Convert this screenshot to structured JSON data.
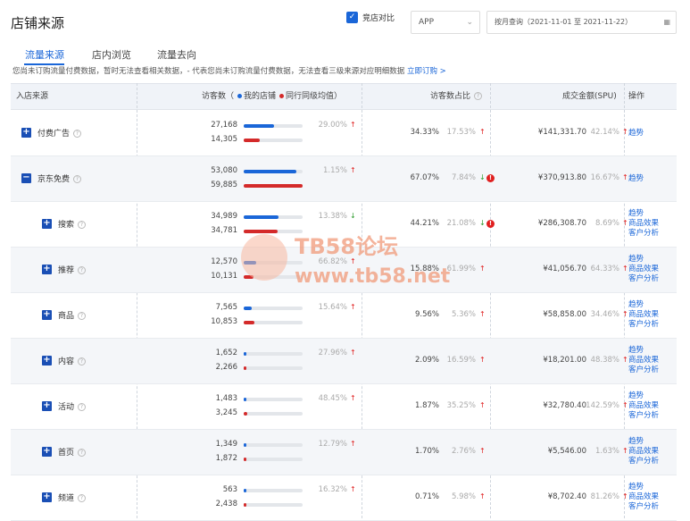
{
  "page": {
    "title": "店铺来源"
  },
  "controls": {
    "compare_label": "竞店对比",
    "platform": "APP",
    "date_range": "按月查询（2021-11-01 至 2021-11-22）"
  },
  "tabs": [
    "流量来源",
    "店内浏览",
    "流量去向"
  ],
  "notice": {
    "text": "您尚未订购流量付费数据，暂时无法查看相关数据，- 代表您尚未订购流量付费数据，无法查看三级来源对应明细数据",
    "link": "立即订购 >"
  },
  "table": {
    "headers": {
      "source": "入店来源",
      "visitors": "访客数（",
      "mine": "我的店铺",
      "peer": "同行同级均值）",
      "share": "访客数占比",
      "amount": "成交金额(SPU)",
      "ops": "操作"
    },
    "rows": [
      {
        "name": "付费广告",
        "icon": "plus-icon",
        "indent": 0,
        "mine": "27,168",
        "peer": "14,305",
        "mine_frac": 0.51,
        "peer_frac": 0.27,
        "pct": "29.00%",
        "pct_dir": "up",
        "share": "34.33%",
        "share_chg": "17.53%",
        "share_dir": "up",
        "share_warn": false,
        "amount": "¥141,331.70",
        "amount_chg": "42.14%",
        "amount_dir": "up",
        "links": [
          "趋势"
        ]
      },
      {
        "name": "京东免费",
        "icon": "minus-icon",
        "indent": 0,
        "mine": "53,080",
        "peer": "59,885",
        "mine_frac": 0.89,
        "peer_frac": 1.0,
        "pct": "1.15%",
        "pct_dir": "up",
        "share": "67.07%",
        "share_chg": "7.84%",
        "share_dir": "down",
        "share_warn": true,
        "amount": "¥370,913.80",
        "amount_chg": "16.67%",
        "amount_dir": "up",
        "links": [
          "趋势"
        ]
      },
      {
        "name": "搜索",
        "icon": "plus-icon",
        "indent": 1,
        "mine": "34,989",
        "peer": "34,781",
        "mine_frac": 0.59,
        "peer_frac": 0.58,
        "pct": "13.38%",
        "pct_dir": "down",
        "share": "44.21%",
        "share_chg": "21.08%",
        "share_dir": "down",
        "share_warn": true,
        "amount": "¥286,308.70",
        "amount_chg": "8.69%",
        "amount_dir": "up",
        "links": [
          "趋势",
          "商品效果",
          "客户分析"
        ]
      },
      {
        "name": "推荐",
        "icon": "plus-icon",
        "indent": 1,
        "mine": "12,570",
        "peer": "10,131",
        "mine_frac": 0.21,
        "peer_frac": 0.17,
        "pct": "66.82%",
        "pct_dir": "up",
        "share": "15.88%",
        "share_chg": "61.99%",
        "share_dir": "up",
        "share_warn": false,
        "amount": "¥41,056.70",
        "amount_chg": "64.33%",
        "amount_dir": "up",
        "links": [
          "趋势",
          "商品效果",
          "客户分析"
        ]
      },
      {
        "name": "商品",
        "icon": "plus-icon",
        "indent": 1,
        "mine": "7,565",
        "peer": "10,853",
        "mine_frac": 0.13,
        "peer_frac": 0.18,
        "pct": "15.64%",
        "pct_dir": "up",
        "share": "9.56%",
        "share_chg": "5.36%",
        "share_dir": "up",
        "share_warn": false,
        "amount": "¥58,858.00",
        "amount_chg": "34.46%",
        "amount_dir": "up",
        "links": [
          "趋势",
          "商品效果",
          "客户分析"
        ]
      },
      {
        "name": "内容",
        "icon": "plus-icon",
        "indent": 1,
        "mine": "1,652",
        "peer": "2,266",
        "mine_frac": 0.03,
        "peer_frac": 0.04,
        "pct": "27.96%",
        "pct_dir": "up",
        "share": "2.09%",
        "share_chg": "16.59%",
        "share_dir": "up",
        "share_warn": false,
        "amount": "¥18,201.00",
        "amount_chg": "48.38%",
        "amount_dir": "up",
        "links": [
          "趋势",
          "商品效果",
          "客户分析"
        ]
      },
      {
        "name": "活动",
        "icon": "plus-icon",
        "indent": 1,
        "mine": "1,483",
        "peer": "3,245",
        "mine_frac": 0.025,
        "peer_frac": 0.054,
        "pct": "48.45%",
        "pct_dir": "up",
        "share": "1.87%",
        "share_chg": "35.25%",
        "share_dir": "up",
        "share_warn": false,
        "amount": "¥32,780.40",
        "amount_chg": "142.59%",
        "amount_dir": "up",
        "links": [
          "趋势",
          "商品效果",
          "客户分析"
        ]
      },
      {
        "name": "首页",
        "icon": "plus-icon",
        "indent": 1,
        "mine": "1,349",
        "peer": "1,872",
        "mine_frac": 0.022,
        "peer_frac": 0.031,
        "pct": "12.79%",
        "pct_dir": "up",
        "share": "1.70%",
        "share_chg": "2.76%",
        "share_dir": "up",
        "share_warn": false,
        "amount": "¥5,546.00",
        "amount_chg": "1.63%",
        "amount_dir": "up",
        "links": [
          "趋势",
          "商品效果",
          "客户分析"
        ]
      },
      {
        "name": "频道",
        "icon": "plus-icon",
        "indent": 1,
        "mine": "563",
        "peer": "2,438",
        "mine_frac": 0.01,
        "peer_frac": 0.04,
        "pct": "16.32%",
        "pct_dir": "up",
        "share": "0.71%",
        "share_chg": "5.98%",
        "share_dir": "up",
        "share_warn": false,
        "amount": "¥8,702.40",
        "amount_chg": "81.26%",
        "amount_dir": "up",
        "links": [
          "趋势",
          "商品效果",
          "客户分析"
        ]
      }
    ]
  },
  "colors": {
    "accent": "#1a66d8",
    "mine": "#1a66d8",
    "peer": "#d42a2a",
    "up": "#e02020",
    "down": "#2a9a2a"
  },
  "watermark": {
    "line1": "TB58论坛",
    "line2": "www.tb58.net"
  }
}
